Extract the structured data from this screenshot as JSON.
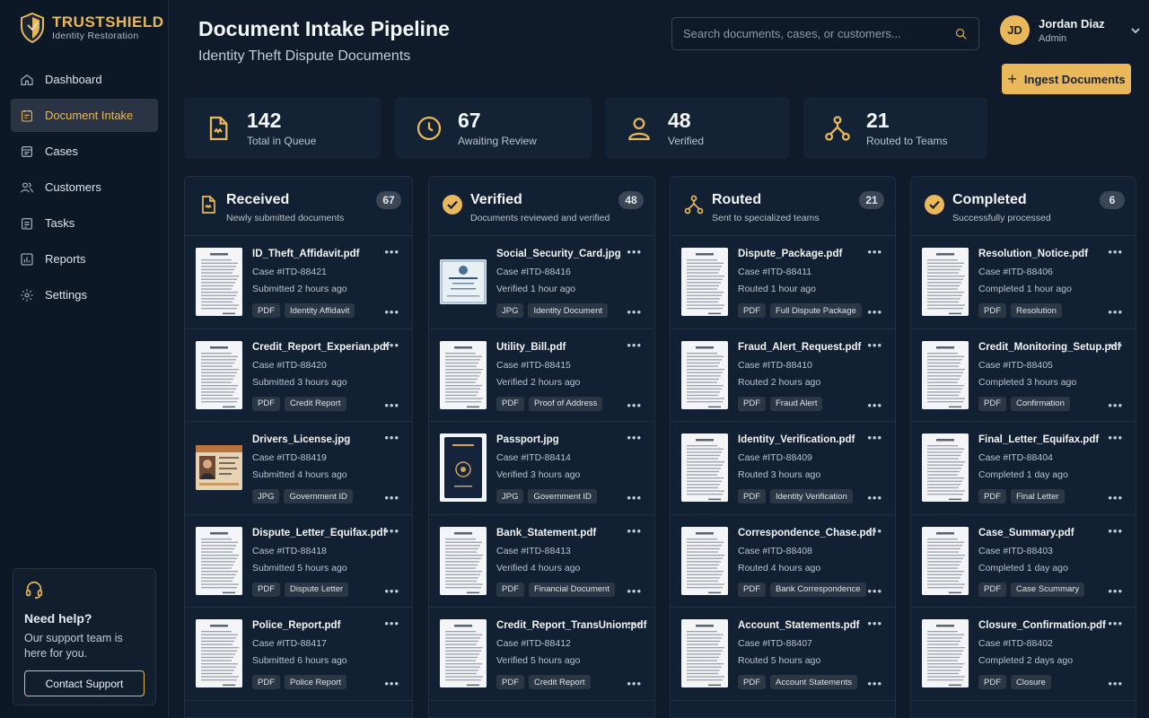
{
  "brand": {
    "name": "TRUSTSHIELD",
    "tagline": "Identity Restoration"
  },
  "nav": [
    {
      "label": "Dashboard",
      "icon": "home-icon"
    },
    {
      "label": "Document Intake",
      "icon": "intake-icon",
      "active": true
    },
    {
      "label": "Cases",
      "icon": "cases-icon"
    },
    {
      "label": "Customers",
      "icon": "customers-icon"
    },
    {
      "label": "Tasks",
      "icon": "tasks-icon"
    },
    {
      "label": "Reports",
      "icon": "reports-icon"
    },
    {
      "label": "Settings",
      "icon": "settings-icon"
    }
  ],
  "help": {
    "title": "Need help?",
    "text": "Our support team is here for you.",
    "button": "Contact Support"
  },
  "header": {
    "title": "Document Intake Pipeline",
    "subtitle": "Identity Theft Dispute Documents",
    "search_placeholder": "Search documents, cases, or customers...",
    "ingest_label": "Ingest Documents"
  },
  "user": {
    "initials": "JD",
    "name": "Jordan Diaz",
    "role": "Admin"
  },
  "stats": [
    {
      "value": "142",
      "label": "Total in Queue",
      "icon": "document-icon"
    },
    {
      "value": "67",
      "label": "Awaiting Review",
      "icon": "clock-icon"
    },
    {
      "value": "48",
      "label": "Verified",
      "icon": "user-icon"
    },
    {
      "value": "21",
      "label": "Routed to Teams",
      "icon": "route-icon"
    }
  ],
  "columns": [
    {
      "title": "Received",
      "subtitle": "Newly submitted documents",
      "count": "67",
      "icon": "document-icon",
      "cards": [
        {
          "name": "ID_Theft_Affidavit.pdf",
          "case": "Case #ITD-88421",
          "time": "Submitted 2 hours ago",
          "type": "PDF",
          "tag": "Identity Affidavit",
          "thumb": "doc"
        },
        {
          "name": "Credit_Report_Experian.pdf",
          "case": "Case #ITD-88420",
          "time": "Submitted 3 hours ago",
          "type": "PDF",
          "tag": "Credit Report",
          "thumb": "doc"
        },
        {
          "name": "Drivers_License.jpg",
          "case": "Case #ITD-88419",
          "time": "Submitted 4 hours ago",
          "type": "JPG",
          "tag": "Government ID",
          "thumb": "license"
        },
        {
          "name": "Dispute_Letter_Equifax.pdf",
          "case": "Case #ITD-88418",
          "time": "Submitted 5 hours ago",
          "type": "PDF",
          "tag": "Dispute Letter",
          "thumb": "doc"
        },
        {
          "name": "Police_Report.pdf",
          "case": "Case #ITD-88417",
          "time": "Submitted 6 hours ago",
          "type": "PDF",
          "tag": "Police Report",
          "thumb": "doc"
        }
      ]
    },
    {
      "title": "Verified",
      "subtitle": "Documents reviewed and verified",
      "count": "48",
      "icon": "check-icon",
      "cards": [
        {
          "name": "Social_Security_Card.jpg",
          "case": "Case #ITD-88416",
          "time": "Verified 1 hour ago",
          "type": "JPG",
          "tag": "Identity Document",
          "thumb": "ssn"
        },
        {
          "name": "Utility_Bill.pdf",
          "case": "Case #ITD-88415",
          "time": "Verified 2 hours ago",
          "type": "PDF",
          "tag": "Proof of Address",
          "thumb": "doc"
        },
        {
          "name": "Passport.jpg",
          "case": "Case #ITD-88414",
          "time": "Verified 3 hours ago",
          "type": "JPG",
          "tag": "Government ID",
          "thumb": "passport"
        },
        {
          "name": "Bank_Statement.pdf",
          "case": "Case #ITD-88413",
          "time": "Verified 4 hours ago",
          "type": "PDF",
          "tag": "Financial Document",
          "thumb": "doc"
        },
        {
          "name": "Credit_Report_TransUnion.pdf",
          "case": "Case #ITD-88412",
          "time": "Verified 5 hours ago",
          "type": "PDF",
          "tag": "Credit Report",
          "thumb": "doc"
        }
      ]
    },
    {
      "title": "Routed",
      "subtitle": "Sent to specialized teams",
      "count": "21",
      "icon": "route-icon",
      "cards": [
        {
          "name": "Dispute_Package.pdf",
          "case": "Case #ITD-88411",
          "time": "Routed 1 hour ago",
          "type": "PDF",
          "tag": "Full Dispute Package",
          "thumb": "doc"
        },
        {
          "name": "Fraud_Alert_Request.pdf",
          "case": "Case #ITD-88410",
          "time": "Routed 2 hours ago",
          "type": "PDF",
          "tag": "Fraud Alert",
          "thumb": "doc"
        },
        {
          "name": "Identity_Verification.pdf",
          "case": "Case #ITD-88409",
          "time": "Routed 3 hours ago",
          "type": "PDF",
          "tag": "Identity Verification",
          "thumb": "doc"
        },
        {
          "name": "Correspondence_Chase.pdf",
          "case": "Case #ITD-88408",
          "time": "Routed 4 hours ago",
          "type": "PDF",
          "tag": "Bank Correspondence",
          "thumb": "doc"
        },
        {
          "name": "Account_Statements.pdf",
          "case": "Case #ITD-88407",
          "time": "Routed 5 hours ago",
          "type": "PDF",
          "tag": "Account Statements",
          "thumb": "doc"
        }
      ]
    },
    {
      "title": "Completed",
      "subtitle": "Successfully processed",
      "count": "6",
      "icon": "check-icon",
      "cards": [
        {
          "name": "Resolution_Notice.pdf",
          "case": "Case #ITD-88406",
          "time": "Completed 1 hour ago",
          "type": "PDF",
          "tag": "Resolution",
          "thumb": "doc"
        },
        {
          "name": "Credit_Monitoring_Setup.pdf",
          "case": "Case #ITD-88405",
          "time": "Completed 3 hours ago",
          "type": "PDF",
          "tag": "Confirmation",
          "thumb": "doc"
        },
        {
          "name": "Final_Letter_Equifax.pdf",
          "case": "Case #ITD-88404",
          "time": "Completed 1 day ago",
          "type": "PDF",
          "tag": "Final Letter",
          "thumb": "doc"
        },
        {
          "name": "Case_Summary.pdf",
          "case": "Case #ITD-88403",
          "time": "Completed 1 day ago",
          "type": "PDF",
          "tag": "Case Scummary",
          "thumb": "doc"
        },
        {
          "name": "Closure_Confirmation.pdf",
          "case": "Case #ITD-88402",
          "time": "Completed 2 days ago",
          "type": "PDF",
          "tag": "Closure",
          "thumb": "doc"
        }
      ]
    }
  ]
}
